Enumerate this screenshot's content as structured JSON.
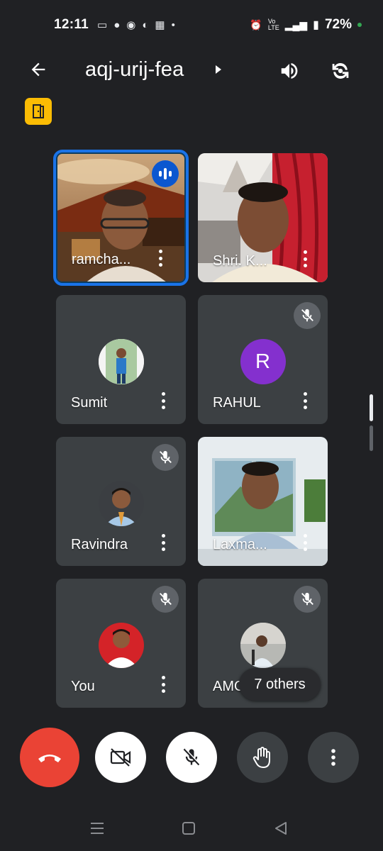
{
  "status": {
    "time": "12:11",
    "battery": "72%",
    "left_icons": [
      "▭",
      "●",
      "◉",
      "◐",
      "▦",
      "•"
    ],
    "network": "⁴ᴳ"
  },
  "header": {
    "title": "aqj-urij-fea"
  },
  "participants": [
    {
      "name": "ramcha...",
      "type": "video",
      "speaking": true,
      "muted": false
    },
    {
      "name": "Shri. K...",
      "type": "video",
      "speaking": false,
      "muted": false
    },
    {
      "name": "Sumit",
      "type": "photo",
      "speaking": false,
      "muted": false
    },
    {
      "name": "RAHUL",
      "type": "letter",
      "letter": "R",
      "speaking": false,
      "muted": true
    },
    {
      "name": "Ravindra",
      "type": "photo",
      "speaking": false,
      "muted": true
    },
    {
      "name": "Laxma...",
      "type": "video",
      "speaking": false,
      "muted": false
    },
    {
      "name": "You",
      "type": "photo",
      "speaking": false,
      "muted": true
    },
    {
      "name": "AMO",
      "type": "photo",
      "speaking": false,
      "muted": true
    }
  ],
  "others_label": "7 others",
  "colors": {
    "background": "#202124",
    "tile": "#3c4043",
    "hangup": "#ea4335",
    "active_border": "#1a73e8",
    "door_badge": "#fbbc04",
    "letter_avatar": "#8430ce"
  }
}
